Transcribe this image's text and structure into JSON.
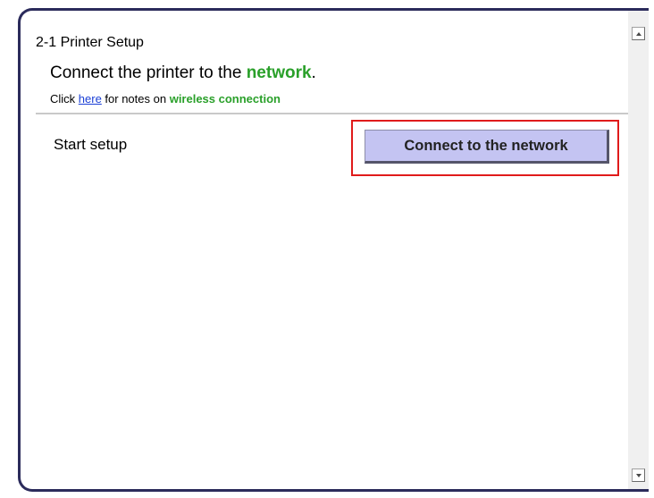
{
  "header": {
    "step_title": "2-1 Printer Setup"
  },
  "instruction": {
    "text_before": "Connect the printer to the ",
    "highlight": "network",
    "text_after": "."
  },
  "note": {
    "prefix": "Click ",
    "link_text": "here",
    "middle": " for notes on ",
    "highlight": "wireless connection"
  },
  "setup": {
    "label": "Start setup",
    "button_label": "Connect to the network"
  },
  "colors": {
    "accent_green": "#2aa02a",
    "link_blue": "#1a3fd6",
    "button_bg": "#c4c4f2",
    "highlight_red": "#e01b1b",
    "frame_border": "#2b2b5b"
  },
  "icons": {
    "scroll_up": "scroll-up-arrow-icon",
    "scroll_down": "scroll-down-arrow-icon"
  }
}
